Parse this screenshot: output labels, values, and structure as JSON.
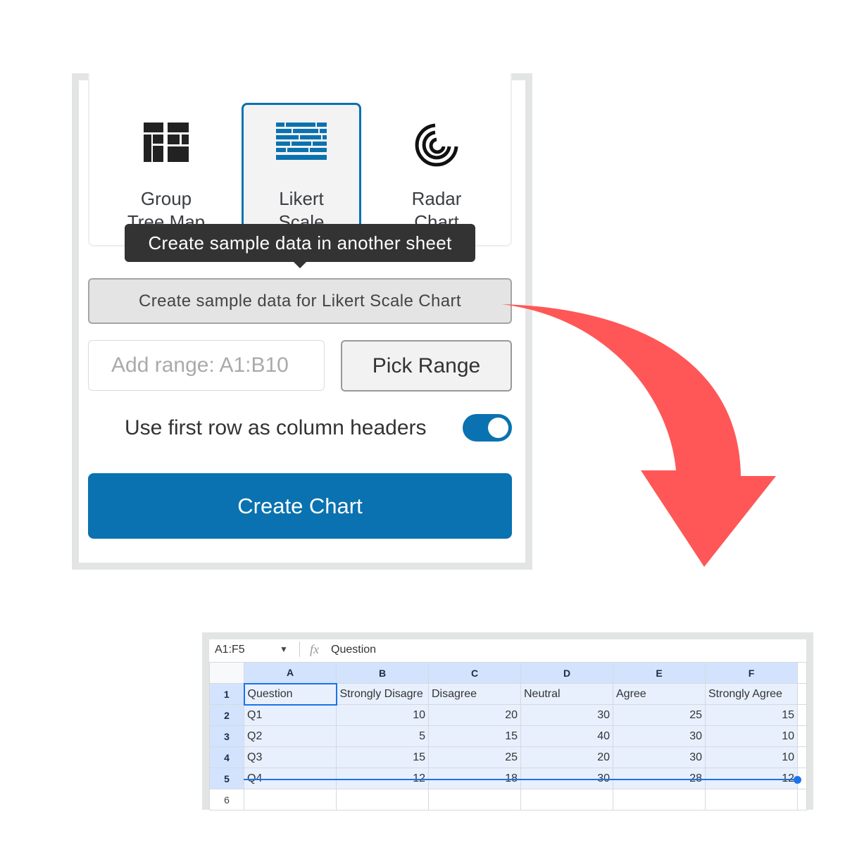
{
  "panel": {
    "chart_types": [
      {
        "label_line1": "Group",
        "label_line2": "Tree Map",
        "icon": "group-tree-map-icon",
        "selected": false
      },
      {
        "label_line1": "Likert",
        "label_line2": "Scale",
        "icon": "likert-scale-icon",
        "selected": true
      },
      {
        "label_line1": "Radar",
        "label_line2": "Chart",
        "icon": "radar-chart-icon",
        "selected": false
      }
    ],
    "tooltip": "Create sample data in another sheet",
    "sample_button": "Create sample data for Likert Scale Chart",
    "range_placeholder": "Add range: A1:B10",
    "pick_range": "Pick Range",
    "header_toggle_label": "Use first row as column headers",
    "header_toggle_on": true,
    "create_chart": "Create Chart",
    "accent": "#0a72b0"
  },
  "arrow_color": "#ff5757",
  "sheet": {
    "name_box": "A1:F5",
    "formula": "Question",
    "columns": [
      "A",
      "B",
      "C",
      "D",
      "E",
      "F"
    ],
    "rows": [
      {
        "n": "1",
        "cells": [
          "Question",
          "Strongly Disagre",
          "Disagree",
          "Neutral",
          "Agree",
          "Strongly Agree"
        ]
      },
      {
        "n": "2",
        "cells": [
          "Q1",
          "10",
          "20",
          "30",
          "25",
          "15"
        ]
      },
      {
        "n": "3",
        "cells": [
          "Q2",
          "5",
          "15",
          "40",
          "30",
          "10"
        ]
      },
      {
        "n": "4",
        "cells": [
          "Q3",
          "15",
          "25",
          "20",
          "30",
          "10"
        ]
      },
      {
        "n": "5",
        "cells": [
          "Q4",
          "12",
          "18",
          "30",
          "28",
          "12"
        ]
      },
      {
        "n": "6",
        "cells": [
          "",
          "",
          "",
          "",
          "",
          ""
        ]
      }
    ]
  }
}
